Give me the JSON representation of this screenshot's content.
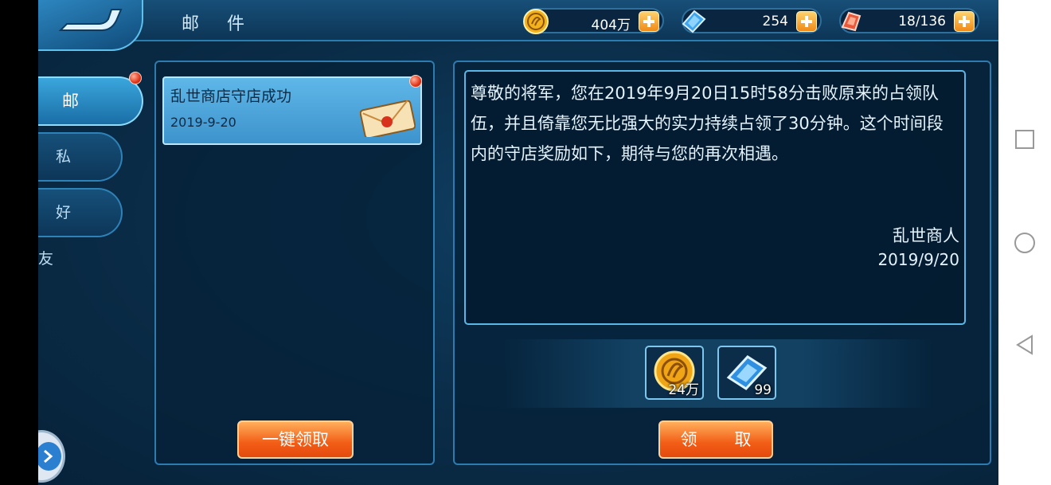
{
  "header": {
    "title": "邮 件",
    "resources": [
      {
        "name": "gold",
        "value": "404万"
      },
      {
        "name": "gem",
        "value": "254"
      },
      {
        "name": "stamina",
        "value": "18/136"
      }
    ]
  },
  "sidebar": {
    "tabs": [
      {
        "label": "邮 件"
      },
      {
        "label": "私 信"
      },
      {
        "label": "好 友"
      }
    ]
  },
  "mail_list": {
    "items": [
      {
        "subject": "乱世商店守店成功",
        "date": "2019-9-20"
      }
    ],
    "claim_all_label": "一键领取"
  },
  "mail_detail": {
    "body": "尊敬的将军，您在2019年9月20日15时58分击败原来的占领队伍，并且倚靠您无比强大的实力持续占领了30分钟。这个时间段内的守店奖励如下，期待与您的再次相遇。",
    "sender": "乱世商人",
    "date": "2019/9/20",
    "rewards": [
      {
        "icon": "gold-coin-icon",
        "quantity": "24万"
      },
      {
        "icon": "blue-gem-icon",
        "quantity": "99"
      }
    ],
    "claim_label": "领 取"
  },
  "colors": {
    "accent": "#2e7bb0",
    "button": "#f25d16",
    "badge": "#e33518"
  }
}
